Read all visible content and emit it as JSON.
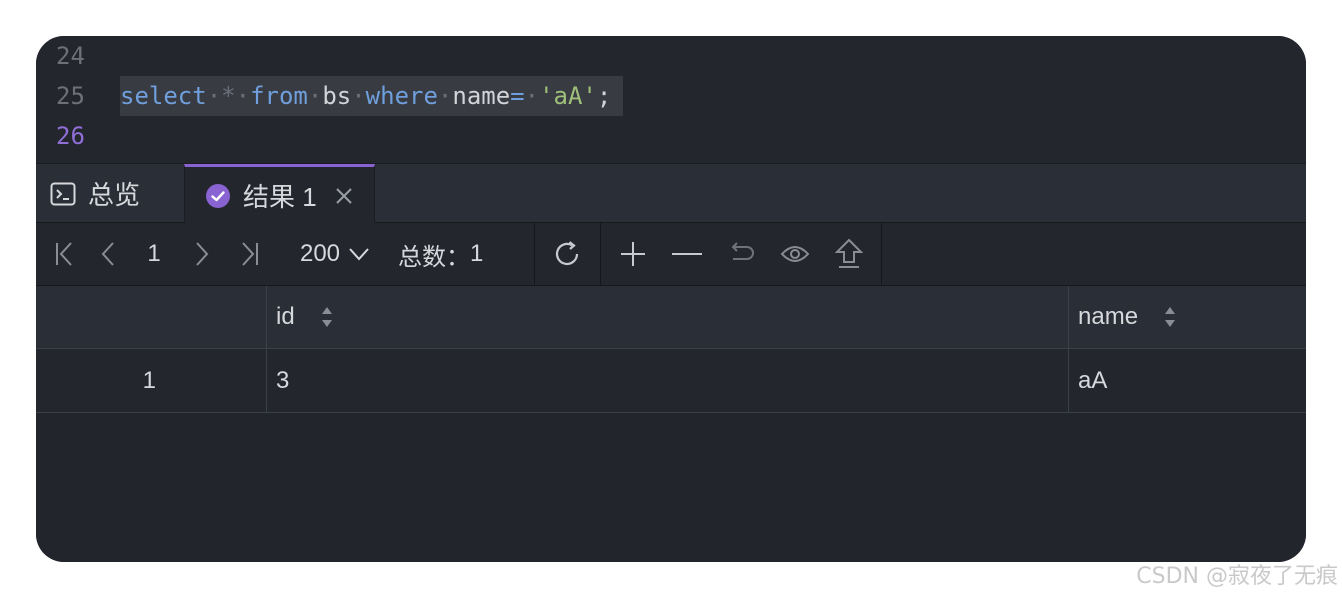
{
  "editor": {
    "lines": [
      {
        "number": "24",
        "code": ""
      },
      {
        "number": "25",
        "tokens": [
          "select",
          "*",
          "from",
          "bs",
          "where",
          "name",
          "=",
          "'aA'",
          ";"
        ]
      },
      {
        "number": "26",
        "code": ""
      }
    ]
  },
  "tabs": [
    {
      "label": "总览",
      "icon": "terminal-icon"
    },
    {
      "label": "结果 1",
      "icon": "check-circle-icon",
      "active": true
    }
  ],
  "toolbar": {
    "page": "1",
    "page_size": "200",
    "total_label": "总数：",
    "total_value": "1"
  },
  "table": {
    "columns": [
      "id",
      "name"
    ],
    "rows": [
      {
        "index": "1",
        "id": "3",
        "name": "aA"
      }
    ]
  },
  "watermark": "CSDN @寂夜了无痕",
  "colors": {
    "accent": "#8a63d2",
    "keyword": "#6f9fdc",
    "string": "#9fc07a",
    "background": "#22252c"
  }
}
